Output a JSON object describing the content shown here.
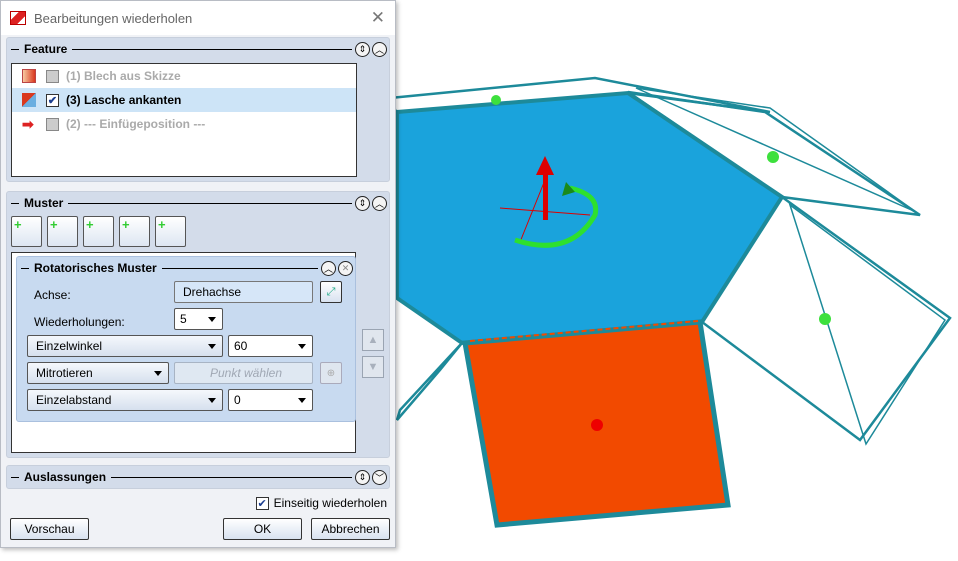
{
  "dialog": {
    "title": "Bearbeitungen wiederholen",
    "close_icon": "close-icon"
  },
  "feature": {
    "title": "Feature",
    "items": [
      {
        "label": "(1) Blech aus Skizze",
        "checked": false,
        "enabled": false
      },
      {
        "label": "(3) Lasche ankanten",
        "checked": true,
        "enabled": true
      },
      {
        "label": "(2) --- Einfügeposition ---",
        "checked": false,
        "enabled": false
      }
    ]
  },
  "muster": {
    "title": "Muster",
    "rot": {
      "title": "Rotatorisches Muster",
      "achse_label": "Achse:",
      "achse_value": "Drehachse",
      "wdh_label": "Wiederholungen:",
      "wdh_value": "5",
      "winkel_mode": "Einzelwinkel",
      "winkel_value": "60",
      "rot_mode": "Mitrotieren",
      "punkt_placeholder": "Punkt wählen",
      "abstand_mode": "Einzelabstand",
      "abstand_value": "0"
    }
  },
  "auslassungen": {
    "title": "Auslassungen"
  },
  "einseitig": {
    "label": "Einseitig wiederholen",
    "checked": true
  },
  "buttons": {
    "preview": "Vorschau",
    "ok": "OK",
    "cancel": "Abbrechen"
  },
  "colors": {
    "hexagon": "#1aa3dc",
    "flap_selected": "#f24a00",
    "edges": "#1d8a9a"
  }
}
